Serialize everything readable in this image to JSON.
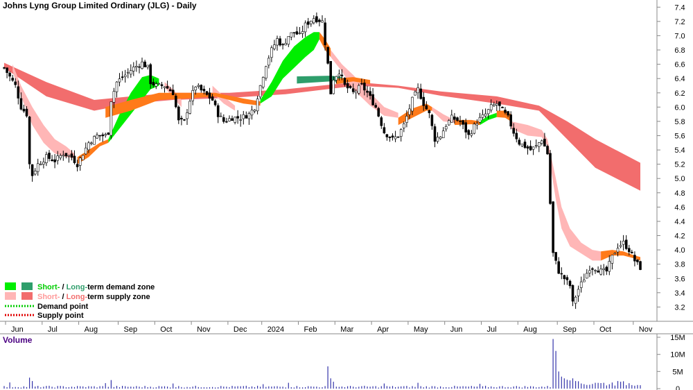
{
  "chart_data": {
    "type": "candlestick",
    "title": "Johns Lyng Group Limited Ordinary (JLG) - Daily",
    "volume_label": "Volume",
    "price_axis": {
      "ylim": [
        3.0,
        7.5
      ],
      "ticks": [
        3.2,
        3.4,
        3.6,
        3.8,
        4.0,
        4.2,
        4.4,
        4.6,
        4.8,
        5.0,
        5.2,
        5.4,
        5.6,
        5.8,
        6.0,
        6.2,
        6.4,
        6.6,
        6.8,
        7.0,
        7.2,
        7.4
      ]
    },
    "volume_axis": {
      "ylim": [
        0,
        15000000
      ],
      "ticks": [
        0,
        5000000,
        10000000,
        15000000
      ],
      "tick_labels": [
        "0",
        "5M",
        "10M",
        "15M"
      ]
    },
    "x_labels": [
      {
        "label": "Jun",
        "t": 0.5
      },
      {
        "label": "Jul",
        "t": 13.5
      },
      {
        "label": "Aug",
        "t": 26.5
      },
      {
        "label": "Sep",
        "t": 40.5
      },
      {
        "label": "Oct",
        "t": 53.5
      },
      {
        "label": "Nov",
        "t": 66.5
      },
      {
        "label": "Dec",
        "t": 79.5
      },
      {
        "label": "2024",
        "t": 91.5
      },
      {
        "label": "Feb",
        "t": 104.5
      },
      {
        "label": "Mar",
        "t": 117.5
      },
      {
        "label": "Apr",
        "t": 130.5
      },
      {
        "label": "May",
        "t": 143.5
      },
      {
        "label": "Jun",
        "t": 156.5
      },
      {
        "label": "Jul",
        "t": 169.5
      },
      {
        "label": "Aug",
        "t": 182.5
      },
      {
        "label": "Sep",
        "t": 196.5
      },
      {
        "label": "Oct",
        "t": 209.5
      },
      {
        "label": "Nov",
        "t": 223.5
      }
    ],
    "t_range": [
      0,
      226
    ],
    "close_path": [
      [
        0,
        6.55
      ],
      [
        4,
        6.3
      ],
      [
        6,
        6.0
      ],
      [
        8,
        5.9
      ],
      [
        9,
        5.2
      ],
      [
        10,
        5.05
      ],
      [
        12,
        5.2
      ],
      [
        15,
        5.3
      ],
      [
        18,
        5.25
      ],
      [
        21,
        5.35
      ],
      [
        24,
        5.3
      ],
      [
        26,
        5.2
      ],
      [
        28,
        5.35
      ],
      [
        30,
        5.5
      ],
      [
        33,
        5.6
      ],
      [
        36,
        5.6
      ],
      [
        37,
        5.65
      ],
      [
        38,
        6.1
      ],
      [
        40,
        6.35
      ],
      [
        43,
        6.45
      ],
      [
        46,
        6.55
      ],
      [
        49,
        6.62
      ],
      [
        51,
        6.55
      ],
      [
        52,
        6.35
      ],
      [
        54,
        6.3
      ],
      [
        57,
        6.3
      ],
      [
        60,
        6.2
      ],
      [
        62,
        5.8
      ],
      [
        64,
        5.8
      ],
      [
        66,
        6.1
      ],
      [
        68,
        6.3
      ],
      [
        71,
        6.2
      ],
      [
        74,
        6.1
      ],
      [
        76,
        5.9
      ],
      [
        78,
        5.8
      ],
      [
        81,
        5.85
      ],
      [
        84,
        5.85
      ],
      [
        87,
        5.9
      ],
      [
        89,
        6.0
      ],
      [
        91,
        6.3
      ],
      [
        93,
        6.6
      ],
      [
        95,
        6.8
      ],
      [
        97,
        6.95
      ],
      [
        99,
        6.85
      ],
      [
        101,
        7.0
      ],
      [
        103,
        7.05
      ],
      [
        105,
        7.0
      ],
      [
        107,
        7.15
      ],
      [
        110,
        7.25
      ],
      [
        113,
        7.2
      ],
      [
        115,
        6.6
      ],
      [
        116,
        6.2
      ],
      [
        117,
        6.4
      ],
      [
        119,
        6.5
      ],
      [
        121,
        6.3
      ],
      [
        124,
        6.2
      ],
      [
        127,
        6.3
      ],
      [
        129,
        6.2
      ],
      [
        132,
        6.0
      ],
      [
        135,
        5.65
      ],
      [
        138,
        5.55
      ],
      [
        140,
        5.6
      ],
      [
        142,
        5.75
      ],
      [
        145,
        6.1
      ],
      [
        147,
        6.25
      ],
      [
        149,
        6.05
      ],
      [
        151,
        5.9
      ],
      [
        153,
        5.55
      ],
      [
        155,
        5.6
      ],
      [
        157,
        5.75
      ],
      [
        159,
        5.85
      ],
      [
        162,
        5.8
      ],
      [
        165,
        5.6
      ],
      [
        168,
        5.8
      ],
      [
        171,
        5.9
      ],
      [
        173,
        6.0
      ],
      [
        175,
        6.05
      ],
      [
        177,
        5.95
      ],
      [
        179,
        5.85
      ],
      [
        181,
        5.65
      ],
      [
        183,
        5.5
      ],
      [
        185,
        5.45
      ],
      [
        187,
        5.4
      ],
      [
        189,
        5.45
      ],
      [
        191,
        5.55
      ],
      [
        193,
        5.35
      ],
      [
        195,
        3.95
      ],
      [
        197,
        3.7
      ],
      [
        199,
        3.6
      ],
      [
        201,
        3.5
      ],
      [
        202,
        3.25
      ],
      [
        204,
        3.45
      ],
      [
        206,
        3.6
      ],
      [
        208,
        3.75
      ],
      [
        210,
        3.75
      ],
      [
        212,
        3.7
      ],
      [
        214,
        3.7
      ],
      [
        216,
        3.9
      ],
      [
        218,
        4.05
      ],
      [
        220,
        4.1
      ],
      [
        222,
        4.0
      ],
      [
        224,
        3.85
      ],
      [
        226,
        3.75
      ]
    ],
    "volume_shape": {
      "base": 600000,
      "spikes": [
        [
          2,
          1800000
        ],
        [
          9,
          3200000
        ],
        [
          10,
          2200000
        ],
        [
          36,
          1600000
        ],
        [
          38,
          2500000
        ],
        [
          60,
          1500000
        ],
        [
          92,
          1300000
        ],
        [
          101,
          1700000
        ],
        [
          115,
          6500000
        ],
        [
          116,
          3000000
        ],
        [
          117,
          2000000
        ],
        [
          135,
          1500000
        ],
        [
          147,
          1700000
        ],
        [
          169,
          1400000
        ],
        [
          195,
          14500000
        ],
        [
          196,
          11000000
        ],
        [
          197,
          5000000
        ],
        [
          198,
          3500000
        ],
        [
          199,
          3000000
        ],
        [
          200,
          2600000
        ],
        [
          201,
          2400000
        ],
        [
          202,
          3000000
        ],
        [
          203,
          2200000
        ],
        [
          210,
          1700000
        ],
        [
          218,
          2200000
        ]
      ]
    },
    "zones": {
      "long_term_supply": [
        [
          0,
          6.62,
          6.55
        ],
        [
          15,
          6.35,
          6.15
        ],
        [
          32,
          6.1,
          5.95
        ],
        [
          45,
          6.15,
          6.05
        ],
        [
          60,
          6.2,
          6.1
        ],
        [
          80,
          6.2,
          6.13
        ],
        [
          100,
          6.25,
          6.18
        ],
        [
          125,
          6.35,
          6.3
        ],
        [
          140,
          6.3,
          6.27
        ],
        [
          155,
          6.22,
          6.16
        ],
        [
          175,
          6.15,
          6.05
        ],
        [
          190,
          6.02,
          5.95
        ],
        [
          200,
          5.8,
          5.55
        ],
        [
          210,
          5.55,
          5.15
        ],
        [
          226,
          5.22,
          4.83
        ]
      ],
      "long_term_demand": [
        [
          104,
          6.43,
          6.33
        ],
        [
          116,
          6.44,
          6.36
        ],
        [
          120,
          6.42,
          6.35
        ]
      ],
      "short_term_supply": [
        [
          [
            3,
            6.6,
            6.5
          ],
          [
            6,
            6.3,
            6.15
          ],
          [
            10,
            6.0,
            5.75
          ],
          [
            14,
            5.75,
            5.5
          ],
          [
            18,
            5.55,
            5.35
          ],
          [
            22,
            5.45,
            5.3
          ],
          [
            25,
            5.35,
            5.28
          ]
        ],
        [
          [
            57,
            6.35,
            6.28
          ],
          [
            60,
            6.25,
            6.13
          ],
          [
            63,
            6.1,
            6.0
          ]
        ],
        [
          [
            74,
            6.3,
            6.2
          ],
          [
            78,
            6.15,
            6.05
          ],
          [
            82,
            6.02,
            5.95
          ]
        ],
        [
          [
            116,
            6.8,
            6.7
          ],
          [
            120,
            6.6,
            6.5
          ],
          [
            124,
            6.45,
            6.25
          ],
          [
            130,
            6.2,
            6.02
          ],
          [
            135,
            6.0,
            5.88
          ],
          [
            140,
            5.92,
            5.85
          ]
        ],
        [
          [
            152,
            6.0,
            5.95
          ],
          [
            156,
            5.9,
            5.8
          ],
          [
            160,
            5.82,
            5.78
          ]
        ],
        [
          [
            180,
            5.8,
            5.7
          ],
          [
            186,
            5.75,
            5.6
          ],
          [
            191,
            5.68,
            5.58
          ],
          [
            193,
            5.55,
            5.45
          ],
          [
            196,
            5.0,
            4.7
          ],
          [
            198,
            4.6,
            4.3
          ],
          [
            201,
            4.3,
            4.05
          ],
          [
            205,
            4.1,
            3.95
          ],
          [
            209,
            4.0,
            3.85
          ],
          [
            212,
            3.98,
            3.85
          ]
        ]
      ],
      "short_term_demand": [
        [
          [
            37,
            5.55,
            5.5
          ],
          [
            41,
            5.9,
            5.7
          ],
          [
            45,
            6.2,
            5.9
          ],
          [
            49,
            6.42,
            6.1
          ],
          [
            52,
            6.45,
            6.25
          ],
          [
            55,
            6.4,
            6.3
          ]
        ],
        [
          [
            91,
            6.1,
            6.05
          ],
          [
            95,
            6.35,
            6.15
          ],
          [
            99,
            6.65,
            6.4
          ],
          [
            103,
            6.85,
            6.55
          ],
          [
            107,
            6.98,
            6.7
          ],
          [
            110,
            7.05,
            6.8
          ],
          [
            112,
            7.05,
            6.95
          ]
        ],
        [
          [
            169,
            5.8,
            5.75
          ],
          [
            172,
            5.88,
            5.82
          ],
          [
            175,
            5.92,
            5.86
          ]
        ]
      ],
      "orange_transition": [
        [
          [
            26,
            5.3,
            5.2
          ],
          [
            30,
            5.4,
            5.3
          ],
          [
            34,
            5.5,
            5.45
          ],
          [
            37,
            5.55,
            5.5
          ]
        ],
        [
          [
            36,
            6.0,
            5.85
          ],
          [
            45,
            6.1,
            5.95
          ],
          [
            55,
            6.2,
            6.1
          ],
          [
            65,
            6.2,
            6.12
          ],
          [
            75,
            6.2,
            6.15
          ],
          [
            85,
            6.12,
            6.05
          ],
          [
            91,
            6.08,
            6.02
          ]
        ],
        [
          [
            112,
            7.05,
            6.95
          ],
          [
            114,
            6.95,
            6.8
          ],
          [
            116,
            6.82,
            6.7
          ]
        ],
        [
          [
            118,
            6.4,
            6.32
          ],
          [
            124,
            6.42,
            6.36
          ],
          [
            130,
            6.38,
            6.32
          ]
        ],
        [
          [
            140,
            5.85,
            5.75
          ],
          [
            145,
            5.98,
            5.85
          ],
          [
            150,
            6.05,
            5.95
          ],
          [
            152,
            6.0,
            5.95
          ]
        ],
        [
          [
            160,
            5.82,
            5.75
          ],
          [
            166,
            5.82,
            5.76
          ],
          [
            169,
            5.8,
            5.75
          ]
        ],
        [
          [
            175,
            5.95,
            5.86
          ],
          [
            178,
            5.95,
            5.85
          ],
          [
            180,
            5.9,
            5.8
          ]
        ],
        [
          [
            212,
            3.98,
            3.85
          ],
          [
            216,
            4.0,
            3.92
          ],
          [
            220,
            3.98,
            3.92
          ],
          [
            224,
            3.92,
            3.88
          ],
          [
            226,
            3.9,
            3.85
          ]
        ]
      ]
    },
    "legend": {
      "zone_row_1_prefix": "Short-",
      "zone_row_1_sep": " / ",
      "zone_row_1_long": "Long-",
      "zone_row_1_suffix": "term demand zone",
      "zone_row_2_prefix": "Short-",
      "zone_row_2_sep": " / ",
      "zone_row_2_long": "Long-",
      "zone_row_2_suffix": "term supply zone",
      "demand_point": "Demand point",
      "supply_point": "Supply point"
    },
    "colors": {
      "short_term_demand": "#00ee00",
      "long_term_demand": "#2e9e6b",
      "short_term_supply": "#ffb6b6",
      "long_term_supply": "#f26d6d",
      "transition": "#ff7a1a",
      "demand_point": "#00cc00",
      "supply_point": "#e00000",
      "volume": "#3333aa",
      "volume_label": "#4b0082",
      "demand_text": "#00cc00",
      "long_demand_text": "#2e9e6b",
      "short_supply_text": "#ff9999",
      "long_supply_text": "#f26d6d"
    }
  }
}
